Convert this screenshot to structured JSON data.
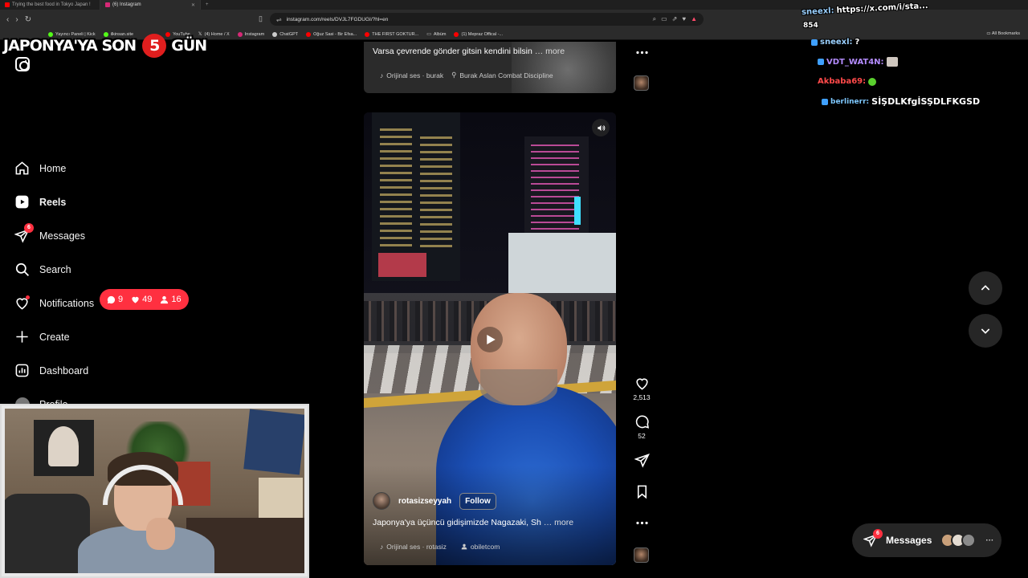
{
  "browser": {
    "tabs": [
      {
        "title": "Trying the best food in Tokyo Japan !",
        "color": "#ff0000",
        "active": false
      },
      {
        "title": "(6) Instagram",
        "color": "#d62976",
        "active": true
      }
    ],
    "url": "instagram.com/reels/DVJL7FGDUGI/?hl=en",
    "bookmarks": [
      "Yayıncı Paneli | Kick",
      "ilkinsan.site",
      "YouTube",
      "(4) Home / X",
      "Instagram",
      "ChatGPT",
      "Oğuz Sasi - Bir Efsa...",
      "THE FIRST GOKTUR...",
      "Albüm",
      "(1) Mepraz Offical -..."
    ],
    "all_bookmarks": "All Bookmarks"
  },
  "overlay": {
    "title_left": "JAPONYA'YA SON",
    "days": "5",
    "title_right": "GÜN"
  },
  "sidebar": {
    "items": [
      {
        "label": "Home",
        "icon": "home-icon"
      },
      {
        "label": "Reels",
        "icon": "reels-icon"
      },
      {
        "label": "Messages",
        "icon": "messages-icon",
        "badge": "6"
      },
      {
        "label": "Search",
        "icon": "search-icon"
      },
      {
        "label": "Notifications",
        "icon": "heart-icon"
      },
      {
        "label": "Create",
        "icon": "plus-icon"
      },
      {
        "label": "Dashboard",
        "icon": "dashboard-icon"
      },
      {
        "label": "Profile",
        "icon": "avatar"
      }
    ],
    "notifications_popup": {
      "comments": "9",
      "likes": "49",
      "follows": "16"
    }
  },
  "reel_prev": {
    "caption": "Varsa çevrende gönder gitsin kendini bilsin",
    "more": "… more",
    "audio": "Orijinal ses · burak",
    "location": "Burak Aslan Combat Discipline"
  },
  "reel_current": {
    "username": "rotasizseyyah",
    "follow_label": "Follow",
    "caption": "Japonya'ya üçüncü gidişimizde Nagazaki, Sh",
    "more": "… more",
    "audio": "Orijinal ses · rotasiz",
    "tagged": "obiletcom",
    "likes": "2,513",
    "comments": "52"
  },
  "messages_pill": {
    "label": "Messages",
    "badge": "6"
  },
  "chat": [
    {
      "user": "sneexl:",
      "msg": "https://x.com/i/sta...",
      "color": "#9ad0ff"
    },
    {
      "user": "",
      "msg": "854",
      "color": "#ffffff"
    },
    {
      "user": "sneexl:",
      "msg": "?",
      "color": "#9ad0ff"
    },
    {
      "user": "VDT_WAT4N:",
      "msg": "",
      "color": "#b48cff"
    },
    {
      "user": "Akbaba69:",
      "msg": "",
      "color": "#ff4a4a"
    },
    {
      "user": "berlinerr:",
      "msg": "SİŞDLKfgİSŞDLFKGSD",
      "color": "#7ec8ff"
    }
  ],
  "colors": {
    "accent": "#ff3040",
    "bg": "#000000",
    "card": "#262626"
  }
}
